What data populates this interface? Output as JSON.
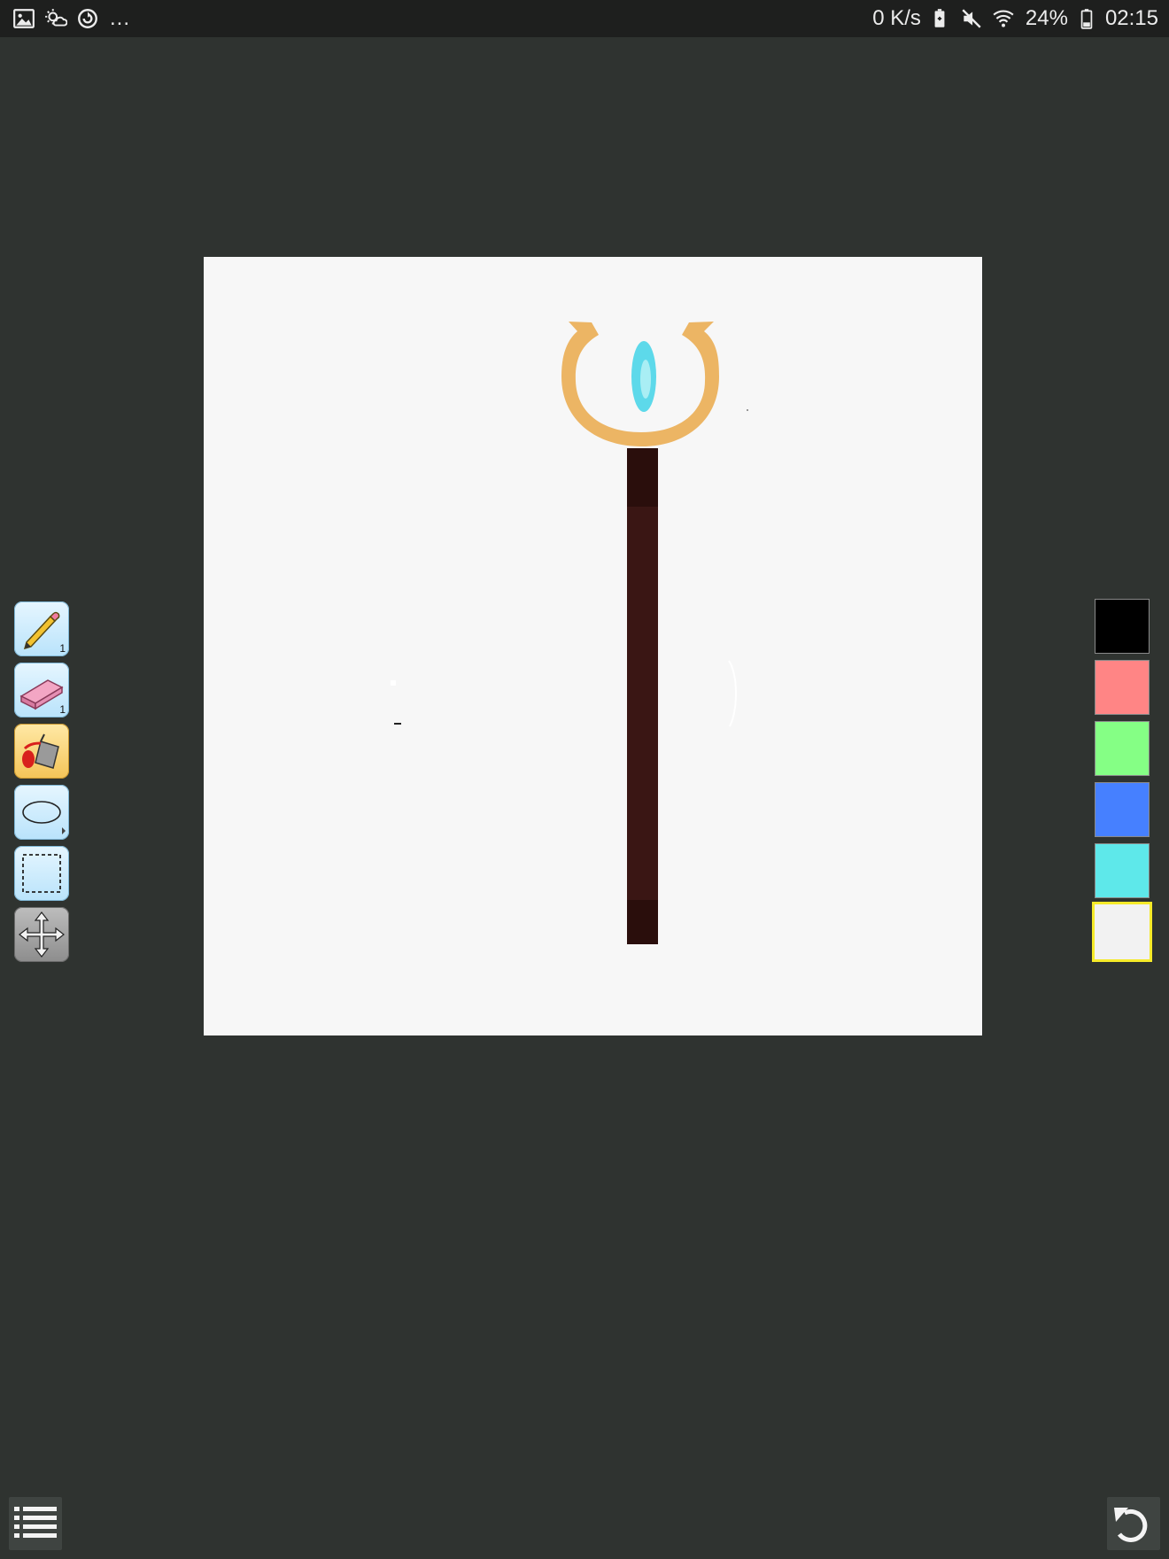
{
  "status_bar": {
    "left_icons": [
      "gallery-icon",
      "weather-icon",
      "sync-icon"
    ],
    "more": "...",
    "net_speed": "0 K/s",
    "battery_percent": "24%",
    "time": "02:15",
    "right_icons": [
      "battery-saver-icon",
      "mute-icon",
      "wifi-icon",
      "battery-icon"
    ]
  },
  "toolbar": {
    "tools": [
      {
        "name": "pencil",
        "icon": "pencil-icon",
        "size": "1",
        "active": false
      },
      {
        "name": "eraser",
        "icon": "eraser-icon",
        "size": "1",
        "active": false
      },
      {
        "name": "fill",
        "icon": "paint-bucket-icon",
        "active": true
      },
      {
        "name": "ellipse",
        "icon": "ellipse-icon",
        "active": false
      },
      {
        "name": "select",
        "icon": "rect-select-icon",
        "active": false
      },
      {
        "name": "move",
        "icon": "move-icon",
        "active": false
      }
    ]
  },
  "palette": {
    "colors": [
      "#000000",
      "#ff8585",
      "#85ff85",
      "#4680ff",
      "#5ee8ea",
      "#f2f2f2"
    ],
    "selected_index": 5
  },
  "canvas": {
    "background": "#f7f7f7",
    "drawing_colors": {
      "gold": "#ecb564",
      "gem": "#5dd9ea",
      "gem_highlight": "#a9eef4",
      "shaft": "#3a1614",
      "shaft_dark": "#2a0e0c"
    }
  },
  "bottom": {
    "menu_icon": "menu-list-icon",
    "undo_icon": "undo-icon"
  }
}
